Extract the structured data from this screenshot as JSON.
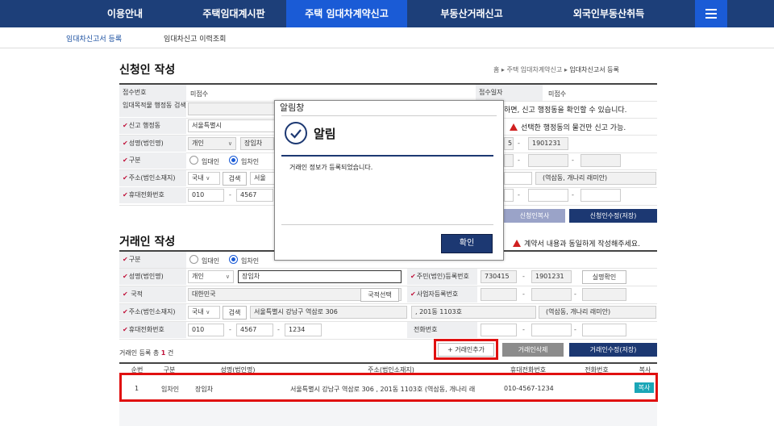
{
  "nav": {
    "items": [
      "이용안내",
      "주택임대계시판",
      "주택 임대차계약신고",
      "부동산거래신고",
      "외국인부동산취득"
    ]
  },
  "subnav": {
    "items": [
      "임대차신고서 등록",
      "임대차신고 이력조회"
    ]
  },
  "applicant": {
    "title": "신청인 작성",
    "breadcrumb": {
      "home": "홈",
      "mid": "주택 임대차계약신고",
      "current": "임대차신고서 등록"
    },
    "receipt_no_label": "접수번호",
    "receipt_no_value": "미접수",
    "receipt_date_label": "접수일자",
    "receipt_date_value": "미접수",
    "search_label": "임대목적물 행정동 검색",
    "notice1": "하면, 신고 행정동을 확인할 수 있습니다.",
    "report_dong_label": "신고 행정동",
    "report_dong_value": "서울특별시",
    "notice2": "선택한 행정동의 물건만 신고 가능.",
    "name_label": "성명(법인명)",
    "person_type": "개인",
    "name_value": "장임차",
    "rrn_front": "5",
    "rrn_back": "1901231",
    "role_label": "구분",
    "role_lessor": "임대인",
    "role_lessee": "임차인",
    "addr_label": "주소(법인소재지)",
    "addr_country": "국내",
    "addr_search": "검색",
    "addr_value": "서울",
    "addr_extra": "(역삼동, 개나리 래미안)",
    "phone_label": "휴대전화번호",
    "phone1": "010",
    "phone2": "4567",
    "copy_btn": "신청인복사",
    "edit_btn": "신청인수정(저장)"
  },
  "dialog": {
    "title": "알림창",
    "heading": "알림",
    "message": "거래인 정보가 등록되었습니다.",
    "ok": "확인"
  },
  "trader": {
    "title": "거래인 작성",
    "notice": "계약서 내용과 동일하게 작성해주세요.",
    "role_label": "구분",
    "role_lessor": "임대인",
    "role_lessee": "임차인",
    "name_label": "성명(법인명)",
    "person_type": "개인",
    "name_value": "장임차",
    "rrn_label": "주민(법인)등록번호",
    "rrn_front": "730415",
    "rrn_back": "1901231",
    "verify_btn": "실명확인",
    "nation_label": "국적",
    "nation_value": "대한민국",
    "nation_btn": "국적선택",
    "bizno_label": "사업자등록번호",
    "addr_label": "주소(법인소재지)",
    "addr_country": "국내",
    "addr_search": "검색",
    "addr_value": "서울특별시 강남구 역삼로 306",
    "addr_detail": ", 201동 1103호",
    "addr_extra": "(역삼동, 개나리 래미안)",
    "phone_label": "휴대전화번호",
    "phone1": "010",
    "phone2": "4567",
    "phone3": "1234",
    "tel_label": "전화번호",
    "count_prefix": "거래인 등록 총",
    "count": "1",
    "count_suffix": "건",
    "add_btn": "+ 거래인추가",
    "delete_btn": "거래인삭제",
    "save_btn": "거래인수정(저장)"
  },
  "table": {
    "headers": [
      "순번",
      "구분",
      "성명(법인명)",
      "주소(법인소재지)",
      "휴대전화번호",
      "전화번호",
      "복사"
    ],
    "rows": [
      {
        "no": "1",
        "role": "임차인",
        "name": "장임차",
        "address": "서울특별시 강남구 역삼로 306 , 201동 1103호 (역삼동, 개나리 래",
        "mobile": "010-4567-1234",
        "tel": "",
        "copy": "복사"
      }
    ]
  }
}
